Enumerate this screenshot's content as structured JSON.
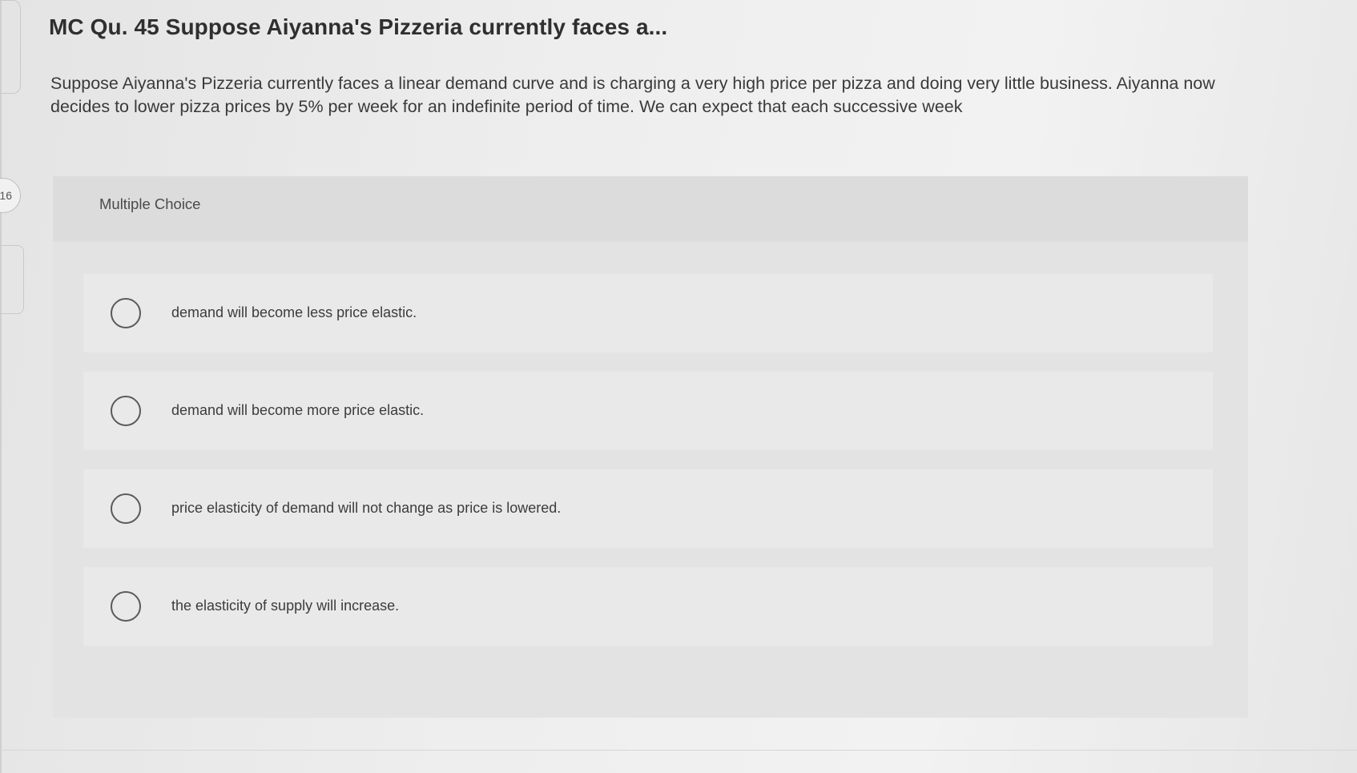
{
  "sidebar": {
    "question_index": "16"
  },
  "question": {
    "title": "MC Qu. 45 Suppose Aiyanna's Pizzeria currently faces a...",
    "prompt": "Suppose Aiyanna's Pizzeria currently faces a linear demand curve and is charging a very high price per pizza and doing very little business. Aiyanna now decides to lower pizza prices by 5% per week for an indefinite period of time. We can expect that each successive week"
  },
  "choices": {
    "header": "Multiple Choice",
    "options": [
      {
        "label": "demand will become less price elastic."
      },
      {
        "label": "demand will become more price elastic."
      },
      {
        "label": "price elasticity of demand will not change as price is lowered."
      },
      {
        "label": "the elasticity of supply will increase."
      }
    ]
  }
}
